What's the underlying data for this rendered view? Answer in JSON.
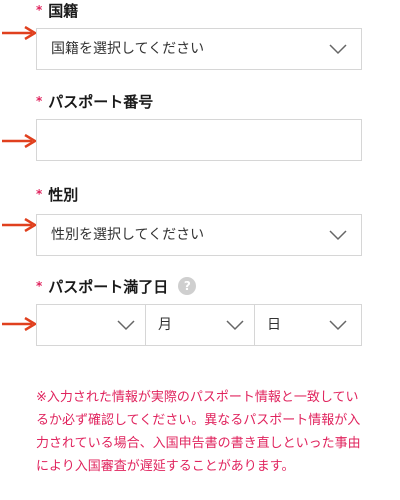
{
  "fields": {
    "nationality": {
      "label": "国籍",
      "placeholder": "国籍を選択してください"
    },
    "passport_number": {
      "label": "パスポート番号",
      "value": ""
    },
    "gender": {
      "label": "性別",
      "placeholder": "性別を選択してください"
    },
    "passport_expiry": {
      "label": "パスポート満了日",
      "year": "",
      "month": "月",
      "day": "日"
    }
  },
  "required_mark": "*",
  "help_icon": "?",
  "note": "※入力された情報が実際のパスポート情報と一致しているか必ず確認してください。異なるパスポート情報が入力されている場合、入国申告書の書き直しといった事由により入国審査が遅延することがあります。",
  "colors": {
    "accent": "#e0245e",
    "border": "#d6d6d6",
    "arrow": "#e0401e"
  },
  "icons": [
    "red-arrow-icon",
    "chevron-down-icon",
    "question-circle-icon"
  ]
}
